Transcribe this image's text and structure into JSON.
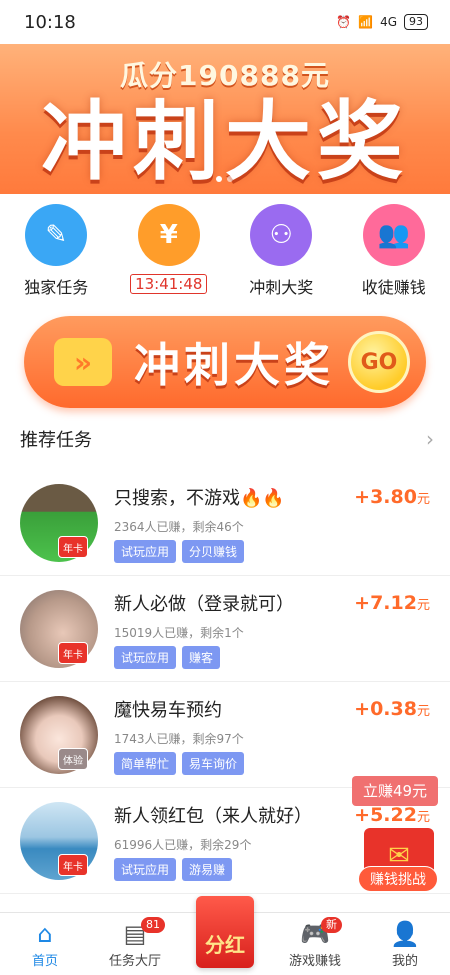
{
  "status_bar": {
    "time": "10:18",
    "network": "4G",
    "battery": "93"
  },
  "banner": {
    "subtitle": "瓜分190888元",
    "headline": "冲刺大奖"
  },
  "quick_actions": [
    {
      "label": "独家任务",
      "icon": "edit-icon",
      "color": "#3aa7f5"
    },
    {
      "label": "13:41:48",
      "icon": "yen-icon",
      "color": "#ff9d2a",
      "is_timer": true
    },
    {
      "label": "冲刺大奖",
      "icon": "network-icon",
      "color": "#9a6bf0"
    },
    {
      "label": "收徒赚钱",
      "icon": "users-icon",
      "color": "#ff6a9a"
    }
  ],
  "sprint_banner": {
    "text": "冲刺大奖",
    "go": "GO"
  },
  "recommend": {
    "title": "推荐任务"
  },
  "tasks": [
    {
      "title": "只搜索，不游戏🔥🔥",
      "meta": "2364人已赚，剩余46个",
      "tags": [
        "试玩应用",
        "分贝赚钱"
      ],
      "reward_value": "+3.80",
      "reward_unit": "元",
      "badge": "年卡"
    },
    {
      "title": "新人必做（登录就可）",
      "meta": "15019人已赚，剩余1个",
      "tags": [
        "试玩应用",
        "赚客"
      ],
      "reward_value": "+7.12",
      "reward_unit": "元",
      "badge": "年卡"
    },
    {
      "title": "魔快易车预约",
      "meta": "1743人已赚，剩余97个",
      "tags": [
        "简单帮忙",
        "易车询价"
      ],
      "reward_value": "+0.38",
      "reward_unit": "元",
      "badge": "体验"
    },
    {
      "title": "新人领红包（来人就好）",
      "meta": "61996人已赚，剩余29个",
      "tags": [
        "试玩应用",
        "游易赚"
      ],
      "reward_value": "+5.22",
      "reward_unit": "元",
      "badge": "年卡"
    }
  ],
  "floating": {
    "earn": "立赚49元",
    "challenge": "赚钱挑战"
  },
  "tabbar": {
    "home": "首页",
    "tasks": "任务大厅",
    "tasks_count": "81",
    "center": "分红",
    "games": "游戏赚钱",
    "games_badge": "新",
    "me": "我的"
  }
}
